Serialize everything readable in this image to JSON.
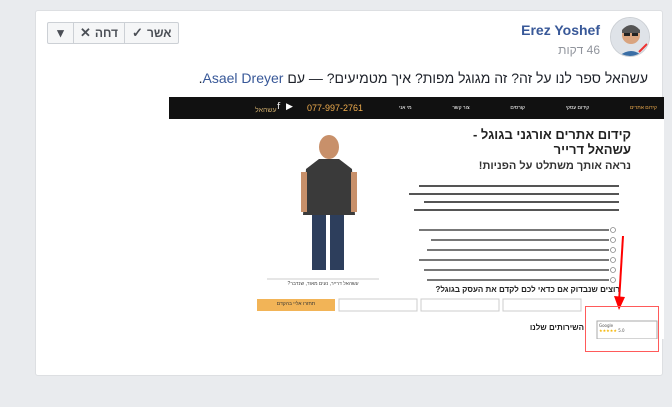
{
  "post": {
    "author": "Erez Yoshef",
    "time": "46 דקות",
    "text_main": "עשהאל ספר לנו על זה? זה מגוגל מפות? איך מטמיעים? — עם",
    "mention": "Asael Dreyer",
    "approve_label": "אשר",
    "decline_label": "דחה"
  },
  "screenshot": {
    "nav_phone": "077-997-2761",
    "nav_logo": "עשהאל",
    "nav_items": [
      "קידום אתרים",
      "קידום עסקי",
      "קורסים",
      "צור קשר",
      "מי אני"
    ],
    "headline_1": "קידום אתרים אורגני בגוגל -",
    "headline_2": "עשהאל דרייר",
    "subheadline": "נראה אותך משתלט על הפניות!",
    "photo_caption": "עשהאל דרייר, נעים מאוד, שנדבר?",
    "cta_question": "רוצים שנבדוק אם כדאי לכם לקדם את העסק בגוגל?",
    "cta_button": "תחזרו אליי בהקדם",
    "services_title": "השירותים שלנו",
    "google_score": "5.0",
    "google_stars": "★★★★★",
    "google_label": "Google"
  },
  "colors": {
    "link": "#385898",
    "cta": "#f0ad4e",
    "arrow": "#ff0000",
    "nav_bg": "#111111"
  }
}
